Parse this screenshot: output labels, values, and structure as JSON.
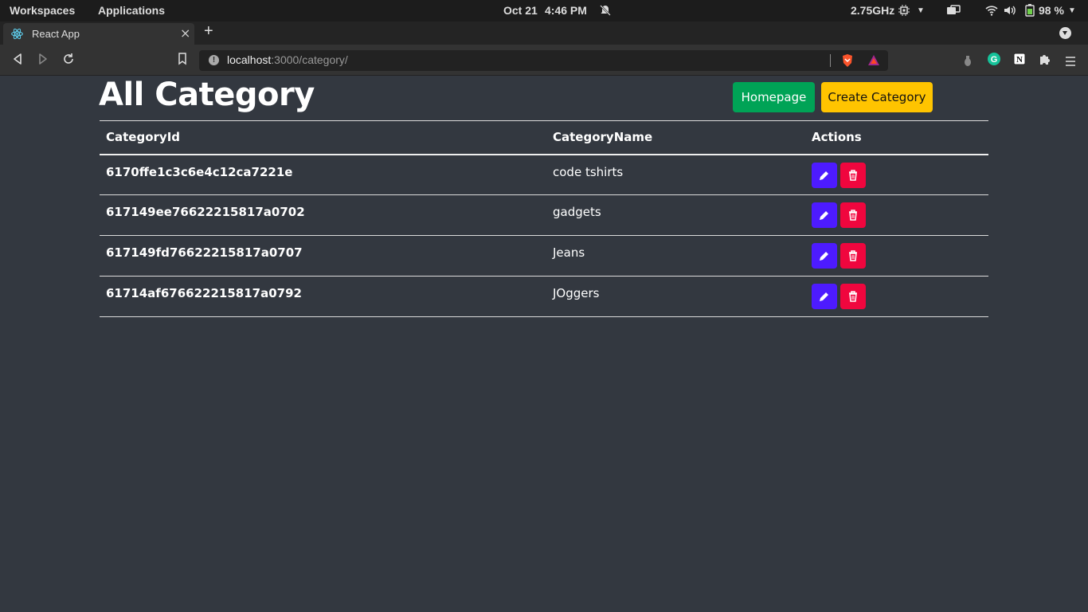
{
  "system_bar": {
    "workspaces": "Workspaces",
    "applications": "Applications",
    "date": "Oct 21",
    "time": "4:46 PM",
    "cpu_freq": "2.75GHz",
    "battery": "98 %",
    "icons": [
      "bell-off-icon",
      "cpu-icon",
      "window-icon",
      "wifi-icon",
      "volume-icon",
      "battery-icon"
    ]
  },
  "browser": {
    "tab_title": "React App",
    "url_host": "localhost",
    "url_path": ":3000/category/",
    "icons": [
      "back-icon",
      "forward-icon",
      "reload-icon",
      "bookmark-icon",
      "brave-shield-icon",
      "brave-rewards-icon",
      "extension-icon",
      "grammarly-icon",
      "notion-icon",
      "puzzle-icon",
      "menu-icon"
    ]
  },
  "page": {
    "title": "All Category",
    "homepage_button": "Homepage",
    "create_button": "Create Category",
    "colors": {
      "homepage": "#00a356",
      "create": "#ffc400",
      "edit": "#4d1bff",
      "delete": "#f0063e",
      "background": "#333840"
    }
  },
  "table": {
    "headers": [
      "CategoryId",
      "CategoryName",
      "Actions"
    ],
    "rows": [
      {
        "id": "6170ffe1c3c6e4c12ca7221e",
        "name": "code tshirts"
      },
      {
        "id": "617149ee76622215817a0702",
        "name": "gadgets"
      },
      {
        "id": "617149fd76622215817a0707",
        "name": "Jeans"
      },
      {
        "id": "61714af676622215817a0792",
        "name": "JOggers"
      }
    ]
  }
}
